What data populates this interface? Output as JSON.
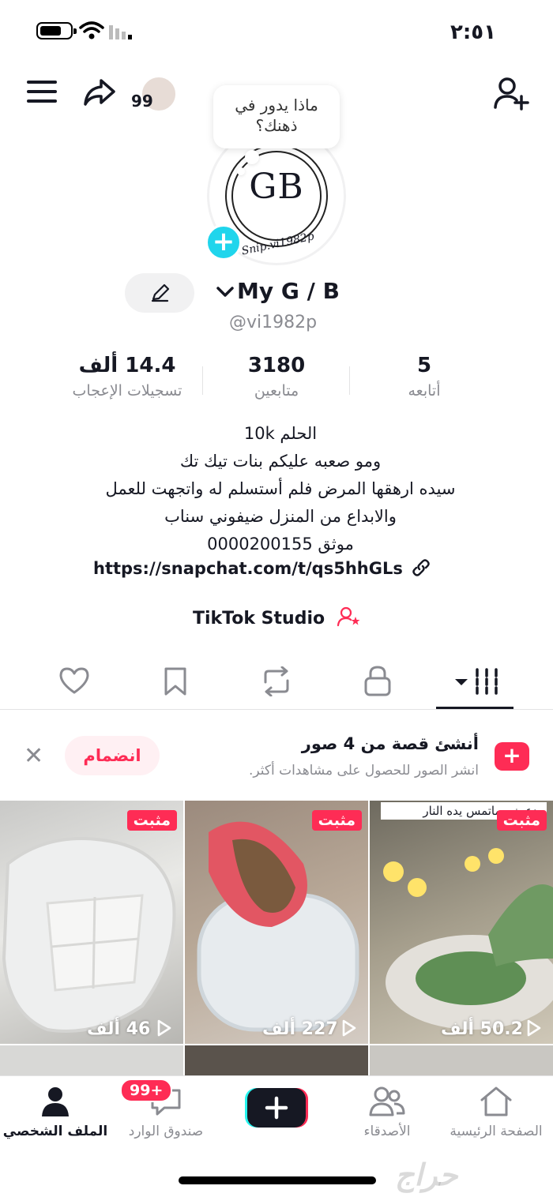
{
  "status_bar": {
    "time": "٢:٥١"
  },
  "header": {
    "follower_count_badge": "99",
    "bubble_text": "ماذا يدور في ذهنك؟"
  },
  "profile": {
    "avatar_text": "GB",
    "avatar_caption": "Snip.vi1982p",
    "name": "My G / B",
    "handle": "@vi1982p",
    "stats": [
      {
        "value": "5",
        "label": "أتابعه"
      },
      {
        "value": "3180",
        "label": "متابعين"
      },
      {
        "value": "14.4 ألف",
        "label": "تسجيلات الإعجاب"
      }
    ],
    "bio_lines": [
      "الحلم 10k",
      "ومو صعبه عليكم بنات تيك تك",
      "سيده ارهقها المرض فلم  أستسلم له واتجهت للعمل",
      "والابداع من المنزل ضيفوني سناب",
      "موثق 0000200155"
    ],
    "link": "https://snapchat.com/t/qs5hhGLs",
    "studio_label": "TikTok Studio"
  },
  "story_banner": {
    "title": "أنشئ قصة من 4 صور",
    "subtitle": "انشر الصور للحصول على مشاهدات أكثر.",
    "join_label": "انضمام"
  },
  "videos": [
    {
      "pinned_label": "مثبت",
      "views": "46 ألف",
      "caption": ""
    },
    {
      "pinned_label": "مثبت",
      "views": "227 ألف",
      "caption": ""
    },
    {
      "pinned_label": "مثبت",
      "views": "50.2 ألف",
      "caption": "بدعمني ماتمس يده النار"
    }
  ],
  "bottom_nav": {
    "items": [
      {
        "label": "الصفحة الرئيسية"
      },
      {
        "label": "الأصدقاء"
      },
      {
        "label": ""
      },
      {
        "label": "صندوق الوارد"
      },
      {
        "label": "الملف الشخصي"
      }
    ],
    "inbox_badge": "99+"
  },
  "colors": {
    "accent": "#fe2c55",
    "cyan": "#20d5ec",
    "muted": "#8a8b91"
  },
  "watermark": "حراج"
}
